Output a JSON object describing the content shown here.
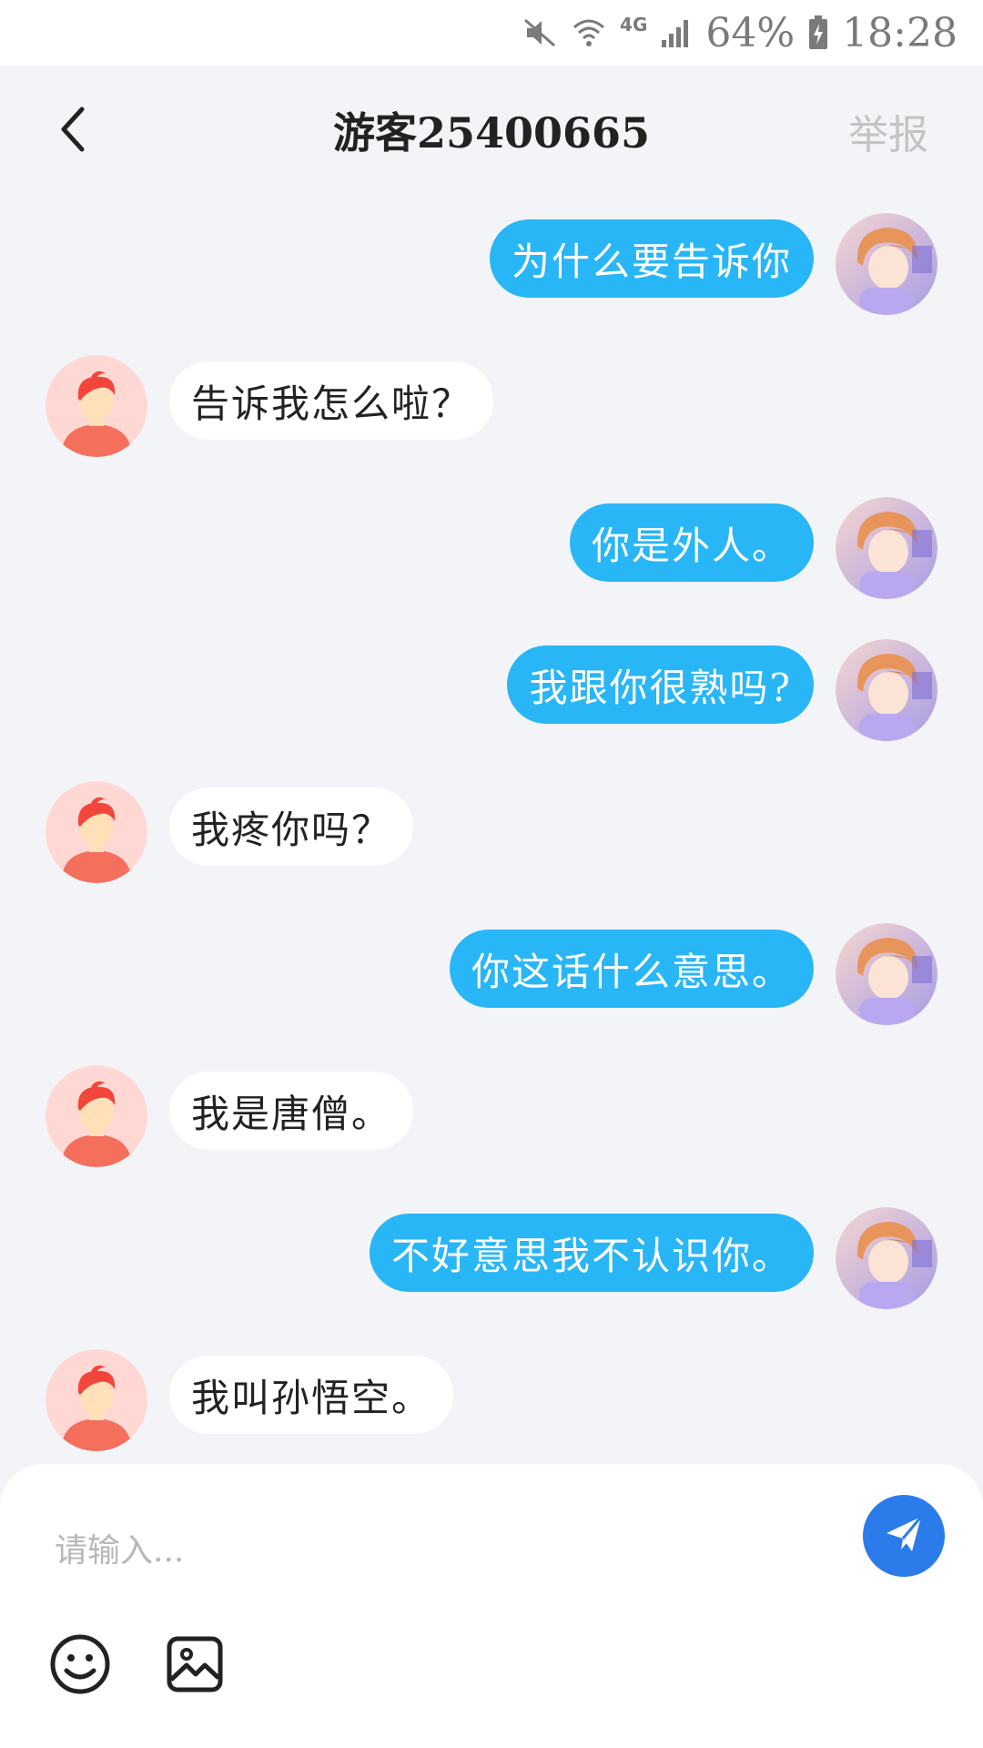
{
  "status_bar": {
    "battery": "64%",
    "time": "18:28",
    "network": "4G",
    "icons": [
      "mute-icon",
      "wifi-icon",
      "signal-icon",
      "battery-icon"
    ]
  },
  "header": {
    "title": "游客25400665",
    "report_label": "举报",
    "back_icon": "chevron-left-icon"
  },
  "messages": [
    {
      "side": "right",
      "text": "为什么要告诉你"
    },
    {
      "side": "left",
      "text": "告诉我怎么啦？"
    },
    {
      "side": "right",
      "text": "你是外人。"
    },
    {
      "side": "right",
      "text": "我跟你很熟吗?"
    },
    {
      "side": "left",
      "text": "我疼你吗？"
    },
    {
      "side": "right",
      "text": "你这话什么意思。"
    },
    {
      "side": "left",
      "text": "我是唐僧。"
    },
    {
      "side": "right",
      "text": "不好意思我不认识你。"
    },
    {
      "side": "left",
      "text": "我叫孙悟空。"
    }
  ],
  "input": {
    "placeholder": "请输入...",
    "value": ""
  },
  "colors": {
    "accent_bubble": "#29b6f6",
    "send_button": "#2b7bea",
    "background": "#f3f4f8"
  }
}
